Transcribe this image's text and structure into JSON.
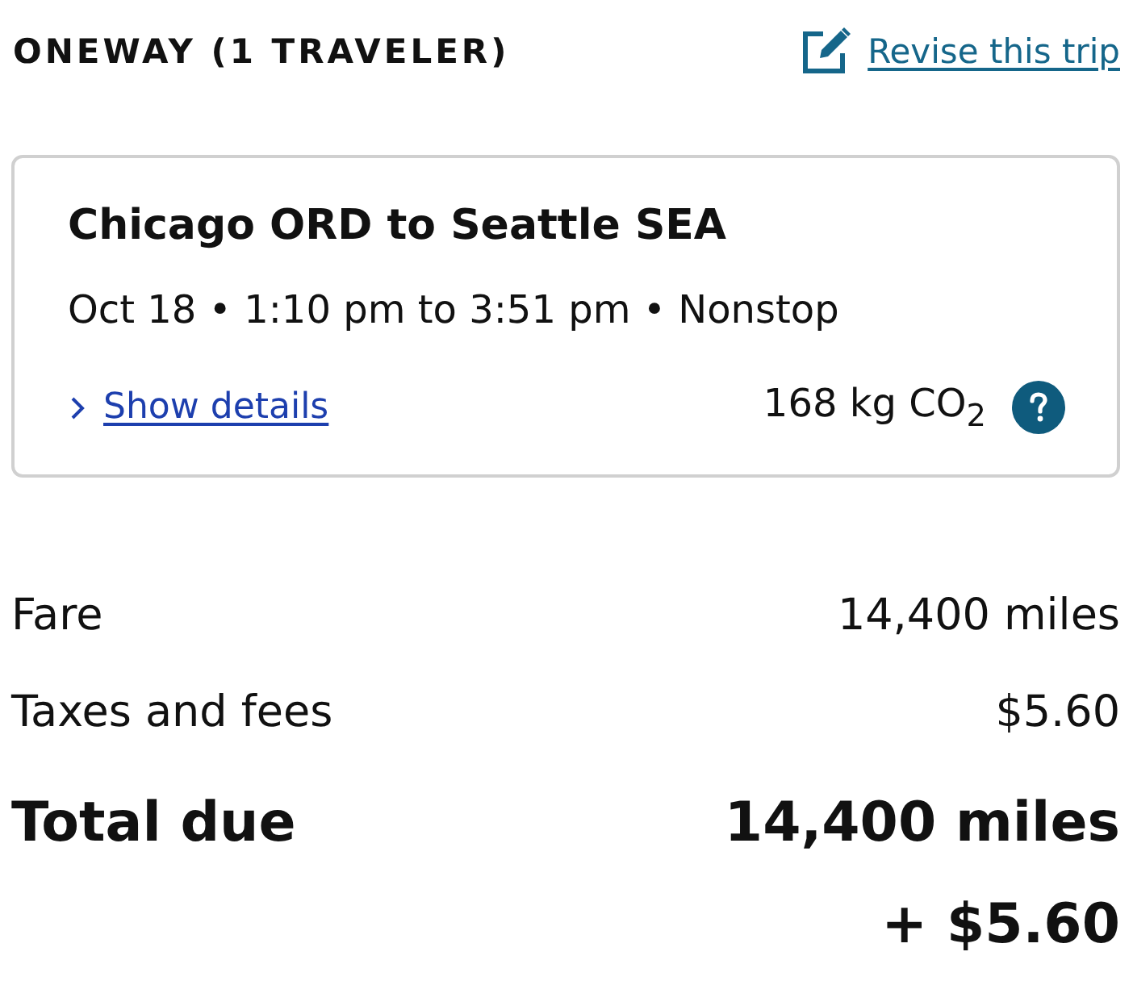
{
  "header": {
    "title": "ONEWAY (1 TRAVELER)",
    "revise_link": "Revise this trip"
  },
  "trip": {
    "route": "Chicago ORD to Seattle SEA",
    "schedule": "Oct 18 • 1:10 pm to 3:51 pm • Nonstop",
    "details_link": {
      "label": "Show details",
      "expanded": false
    },
    "emissions": "168 kg CO$_{2}$"
  },
  "price": {
    "rows": [
      {
        "kind": "line",
        "label": "Fare",
        "values": [
          "14,400 miles"
        ]
      },
      {
        "kind": "line",
        "label": "Taxes and fees",
        "values": [
          "$5.60"
        ]
      },
      {
        "kind": "total",
        "label": "Total due",
        "values": [
          "14,400 miles",
          "+ $5.60"
        ]
      }
    ]
  }
}
